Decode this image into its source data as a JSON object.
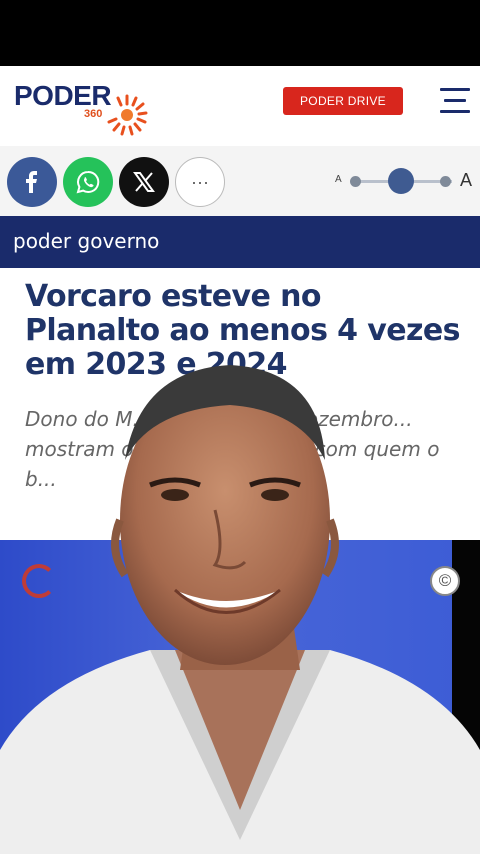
{
  "header": {
    "logo_text": "PODER",
    "logo_sub": "360",
    "drive_label": "PODER DRIVE"
  },
  "share": {
    "more_label": "···",
    "font_small": "A",
    "font_big": "A"
  },
  "section": {
    "label": "poder governo"
  },
  "article": {
    "headline": "Vorcaro esteve no Planalto ao menos 4 vezes em 2023 e 2024",
    "summary": "Dono do M... com Lula em dezembro... mostram outras 3 v... alham com quem o b..."
  },
  "photo": {
    "copyright_symbol": "©"
  },
  "colors": {
    "brand_navy": "#1a2b6b",
    "brand_red": "#d8261d",
    "facebook": "#3b5998",
    "whatsapp": "#25c25a"
  }
}
